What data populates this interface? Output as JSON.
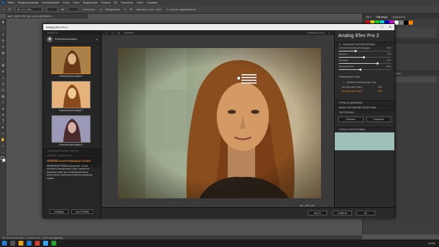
{
  "ps": {
    "menu": [
      "Файл",
      "Редактирование",
      "Изображение",
      "Слои",
      "Текст",
      "Выделение",
      "Фильтр",
      "3D",
      "Просмотр",
      "Окно",
      "Справка"
    ],
    "logo": "Ps",
    "options": {
      "ratio": "W x H x Ra...",
      "clear": "Очистить",
      "straighten": "Выпрямить",
      "delete_cropped": "Удалить отсеч. пикс.",
      "content_aware": "С учетом содержимого"
    },
    "doc_tab": "IMG_9323.CR2 @ 16,6% (RGB/8*) ×",
    "status": "16,75%      6016 пикс. x 4016 пикс. (240 пикс/дюйм)",
    "right_tabs": [
      "Цвет",
      "Образцы",
      "Градиенты"
    ],
    "right_tabs2": [
      "Свойства",
      "Коррекция"
    ],
    "right_tabs3": [
      "Слои",
      "Каналы",
      "Контуры"
    ],
    "swatch_colors": [
      "#ff0000",
      "#ffff00",
      "#00ff00",
      "#00ffff",
      "#0000ff",
      "#ff00ff",
      "#ffffff",
      "#808080",
      "#000000",
      "#ff8000"
    ],
    "clock": "23:55"
  },
  "plugin": {
    "title": "Analog Efex Pro 2",
    "left": {
      "section_title": "КАМЕРА",
      "category": "Классическая камера",
      "presets": [
        {
          "name": "Классическая камера 1"
        },
        {
          "name": "Классическая камера 2"
        },
        {
          "name": "Классическая камера 3"
        }
      ],
      "collapsed": [
        "ИНДИВИДУАЛЬНЫЕ НАБОРЫ",
        "ИМПОРТ / ОБРАБОТКА",
        "ИСТОРИЯ",
        "КНОПКИ СПРАВКИ"
      ],
      "help_title": "СПИСОК КОНТРОЛЬНЫХ ТОЧЕК",
      "help_text": "Контрольные точки изображения. Чтобы отключить контрольную точку, снимите ее флажком слева. Для отображения маски контрольной точки воспользуйтесь флажком справа.",
      "btn_help": "СПРАВКА",
      "btn_settings": "НАСТРОЙКИ"
    },
    "preview": {
      "view_label": "Сравнить",
      "zoom_label": "Масштаб (100%)",
      "caption_line1": "IMG_9323.CR2",
      "caption_line2": "15.9 MP 200 ISO  f/3.2  4916 Kt"
    },
    "right": {
      "brand": "Analog Efex Pro",
      "brand_version": "2",
      "basic_section": "БАЗОВЫЕ КОРРЕКТИРОВКИ",
      "sliders": [
        {
          "label": "Мелкопленочная детализация",
          "value": "32%",
          "pct": 0.32
        },
        {
          "label": "Яркость",
          "value": "-2%",
          "pct": 0.48
        },
        {
          "label": "Контраст",
          "value": "47%",
          "pct": 0.74
        },
        {
          "label": "Насыщенность",
          "value": "-15%",
          "pct": 0.42
        }
      ],
      "cp_section": "Контрольные точки",
      "add_cp": "Добавить контрольную точку",
      "cp_items": [
        {
          "name": "Контрольная точка 1",
          "pct": "25%"
        },
        {
          "name": "Контрольная точка 2",
          "pct": "25%"
        }
      ],
      "sections": [
        "ГРЯЗЬ И ЦАРАПИНЫ",
        "ВИНЬЕТИРОВАНИЕ ОБЪЕКТИВА",
        "ТИП ПЛЕНКИ"
      ],
      "btn_reset": "Сбросить",
      "btn_save": "Сохранить",
      "loupe_section": "ЛУПА И ГИСТОГРАММА"
    },
    "bottom": {
      "btn_brush": "КИСТЬ",
      "btn_cancel": "ОТМЕНА",
      "btn_ok": "OK"
    }
  }
}
